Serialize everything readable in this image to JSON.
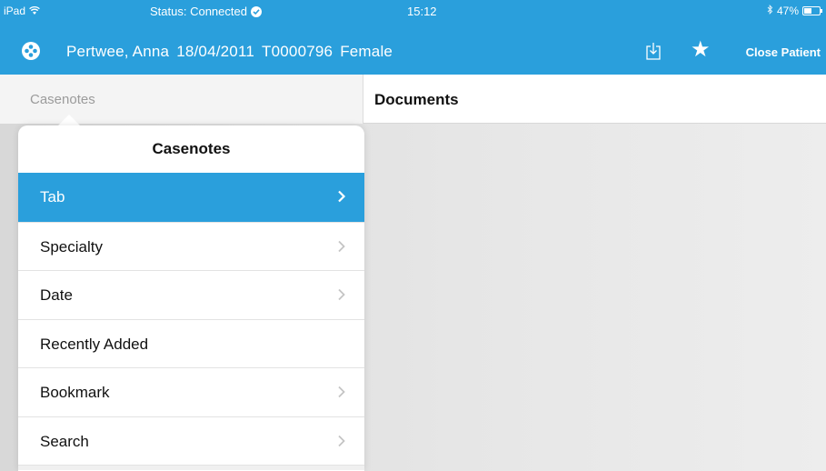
{
  "status_bar": {
    "device": "iPad",
    "status": "Status: Connected",
    "time": "15:12",
    "battery": "47%"
  },
  "patient": {
    "name": "Pertwee, Anna",
    "dob": "18/04/2011",
    "id": "T0000796",
    "gender": "Female",
    "close_label": "Close Patient"
  },
  "nav": {
    "back_label": "Casenotes",
    "title": "Documents"
  },
  "popover": {
    "title": "Casenotes",
    "items": [
      {
        "label": "Tab",
        "selected": true,
        "chevron": true
      },
      {
        "label": "Specialty",
        "selected": false,
        "chevron": true
      },
      {
        "label": "Date",
        "selected": false,
        "chevron": true
      },
      {
        "label": "Recently Added",
        "selected": false,
        "chevron": false
      },
      {
        "label": "Bookmark",
        "selected": false,
        "chevron": true
      },
      {
        "label": "Search",
        "selected": false,
        "chevron": true
      }
    ]
  },
  "colors": {
    "accent": "#2a9fdc",
    "chevron_muted": "#c4c4c4"
  }
}
